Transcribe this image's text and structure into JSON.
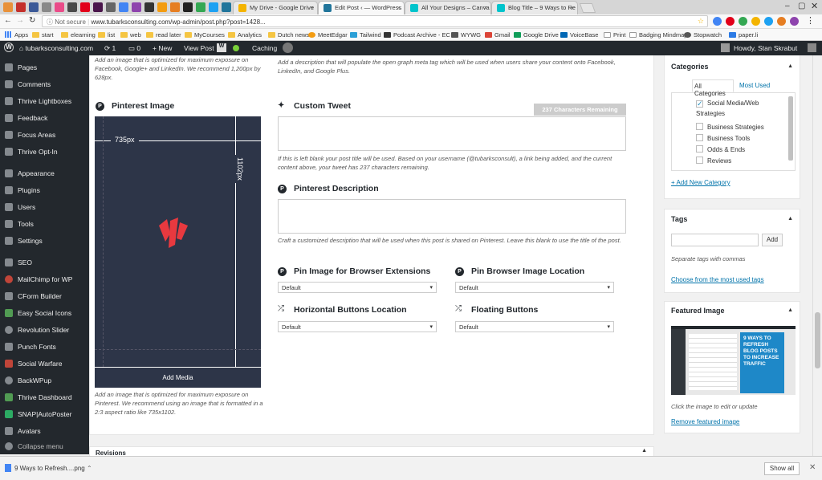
{
  "browser": {
    "tabs": [
      {
        "label": "My Drive - Google Drive",
        "icon_color": "#f4b400"
      },
      {
        "label": "Edit Post ‹ — WordPress",
        "icon_color": "#21759b",
        "active": true
      },
      {
        "label": "All Your Designs – Canva",
        "icon_color": "#00c4cc"
      },
      {
        "label": "Blog Title – 9 Ways to Re",
        "icon_color": "#00c4cc"
      }
    ],
    "not_secure": "Not secure",
    "url": "www.tubarksconsulting.com/wp-admin/post.php?post=1428...",
    "bookmarks": [
      "Apps",
      "start",
      "elearning",
      "list",
      "web",
      "read later",
      "MyCourses",
      "Analytics",
      "Dutch news",
      "MeetEdgar",
      "Tailwind",
      "Podcast Archive - EC",
      "WYWG",
      "Gmail",
      "Google Drive",
      "VoiceBase",
      "Print",
      "Badging Mindmap",
      "Stopwatch",
      "paper.li"
    ]
  },
  "adminbar": {
    "site": "tubarksconsulting.com",
    "updates": "1",
    "comments": "0",
    "new": "+ New",
    "view_post": "View Post",
    "caching": "Caching",
    "howdy": "Howdy, Stan Skrabut"
  },
  "sidebar": {
    "items": [
      "Pages",
      "Comments",
      "Thrive Lightboxes",
      "Feedback",
      "Focus Areas",
      "Thrive Opt-In",
      "Appearance",
      "Plugins",
      "Users",
      "Tools",
      "Settings",
      "SEO",
      "MailChimp for WP",
      "CForm Builder",
      "Easy Social Icons",
      "Revolution Slider",
      "Punch Fonts",
      "Social Warfare",
      "BackWPup",
      "Thrive Dashboard",
      "SNAP|AutoPoster",
      "Avatars",
      "Collapse menu"
    ]
  },
  "main": {
    "top_note_left": "Add an image that is optimized for maximum exposure on Facebook, Google+ and LinkedIn. We recommend 1,200px by 628px.",
    "top_note_right": "Add a description that will populate the open graph meta tag which will be used when users share your content onto Facebook, LinkedIn, and Google Plus.",
    "pinterest_image": {
      "title": "Pinterest Image",
      "width_label": "735px",
      "height_label": "1102px",
      "button": "Add Media",
      "note": "Add an image that is optimized for maximum exposure on Pinterest. We recommend using an image that is formatted in a 2:3 aspect ratio like 735x1102."
    },
    "custom_tweet": {
      "title": "Custom Tweet",
      "counter": "237 Characters Remaining",
      "value": "",
      "note": "If this is left blank your post title will be used. Based on your username (@tubarksconsult), a link being added, and the current content above, your tweet has 237 characters remaining."
    },
    "pinterest_description": {
      "title": "Pinterest Description",
      "value": "",
      "note": "Craft a customized description that will be used when this post is shared on Pinterest. Leave this blank to use the title of the post."
    },
    "pin_image_ext": {
      "title": "Pin Image for Browser Extensions",
      "value": "Default"
    },
    "pin_browser_loc": {
      "title": "Pin Browser Image Location",
      "value": "Default"
    },
    "horizontal_buttons": {
      "title": "Horizontal Buttons Location",
      "value": "Default"
    },
    "floating_buttons": {
      "title": "Floating Buttons",
      "value": "Default"
    },
    "revisions": "Revisions"
  },
  "categories": {
    "title": "Categories",
    "tab_all": "All Categories",
    "tab_most": "Most Used",
    "items": [
      {
        "label": "Social Media/Web Strategies",
        "checked": true
      },
      {
        "label": "Business Strategies",
        "checked": false
      },
      {
        "label": "Business Tools",
        "checked": false
      },
      {
        "label": "Odds & Ends",
        "checked": false
      },
      {
        "label": "Reviews",
        "checked": false
      }
    ],
    "add_new": "+ Add New Category"
  },
  "tags": {
    "title": "Tags",
    "add_button": "Add",
    "input_value": "",
    "note": "Separate tags with commas",
    "choose_link": "Choose from the most used tags"
  },
  "featured": {
    "title": "Featured Image",
    "thumb_text": "9 WAYS TO REFRESH BLOG POSTS TO INCREASE TRAFFIC",
    "note": "Click the image to edit or update",
    "remove_link": "Remove featured image"
  },
  "download": {
    "file": "9 Ways to Refresh....png",
    "show_all": "Show all"
  },
  "colors": {
    "wp_dark": "#23282d",
    "link": "#0073aa",
    "pin_bg": "#2d3548",
    "pin_red": "#e8393f"
  }
}
